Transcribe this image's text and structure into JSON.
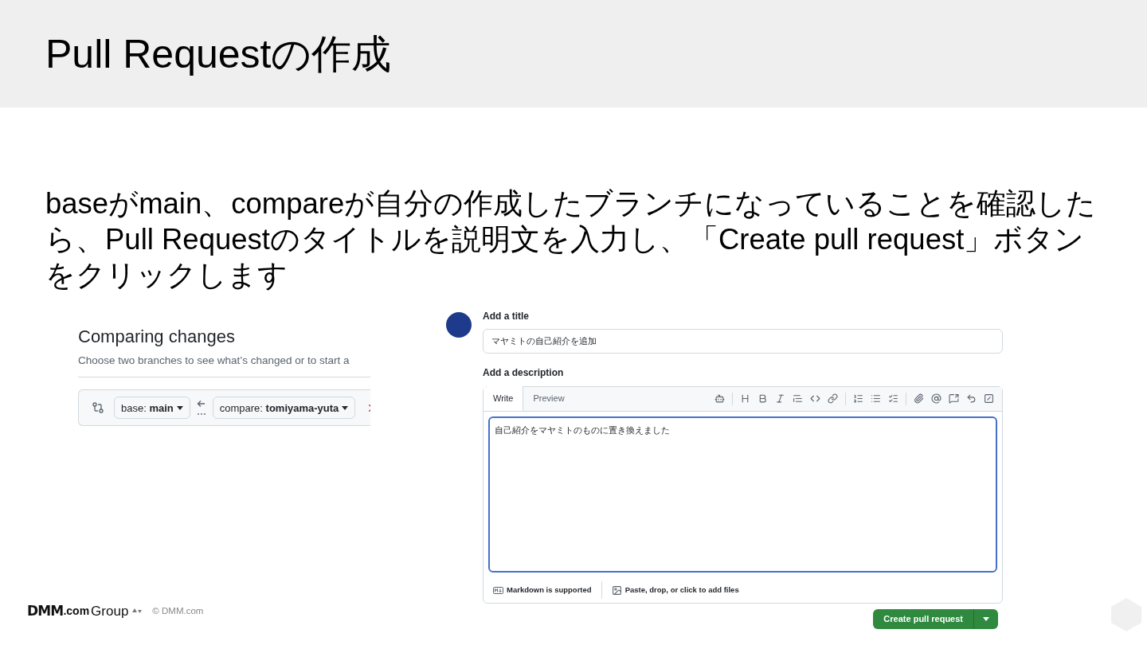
{
  "slide": {
    "title": "Pull Requestの作成",
    "body": "baseがmain、compareが自分の作成したブランチになっていることを確認したら、Pull Requestのタイトルを説明文を入力し、「Create pull request」ボタンをクリックします"
  },
  "compare_panel": {
    "heading": "Comparing changes",
    "subtitle": "Choose two branches to see what’s changed or to start a",
    "base_branch": "base: **main**",
    "compare_branch": "compare: **tomiyama-yuta**"
  },
  "pull_request_form": {
    "title_label": "Add a title",
    "title_value": "マヤミトの自己紹介を追加",
    "description_label": "Add a description",
    "tabs": [
      {
        "label": "Write",
        "selected": true
      },
      {
        "label": "Preview",
        "selected": false
      }
    ],
    "description_value": "自己紹介をマヤミトのものに置き換えました",
    "footer_notes": [
      "Markdown is supported",
      "Paste, drop, or click to add files"
    ],
    "submit_button": "Create pull request"
  },
  "footer": {
    "logo_main": "DMM",
    "logo_suffix": ".com",
    "logo_group": "Group",
    "copyright": "© DMM.com"
  }
}
